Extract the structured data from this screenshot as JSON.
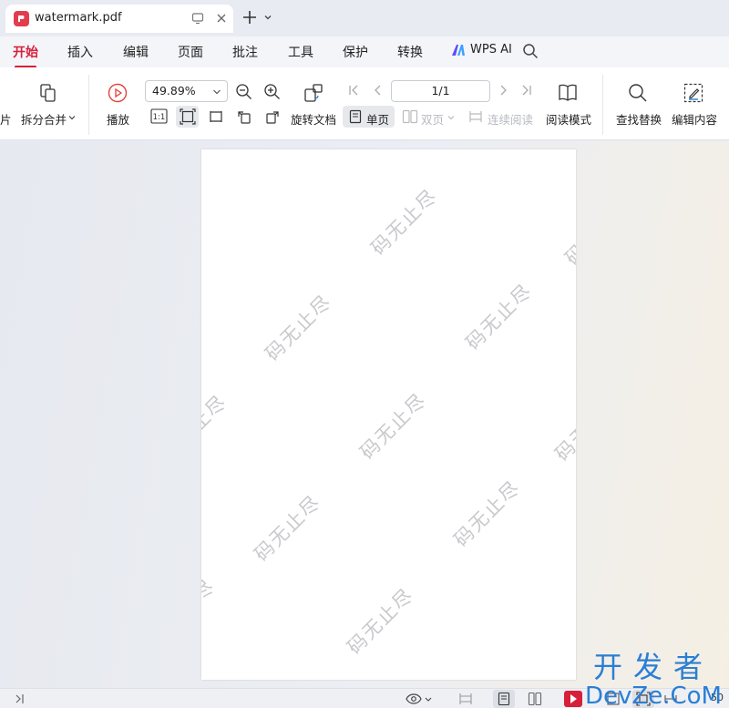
{
  "tab": {
    "title": "watermark.pdf",
    "icon": "pdf-icon"
  },
  "menu": {
    "items": [
      "开始",
      "插入",
      "编辑",
      "页面",
      "批注",
      "工具",
      "保护",
      "转换"
    ],
    "ai_label": "WPS AI"
  },
  "toolbar": {
    "partial_left": "片",
    "split_merge": "拆分合并",
    "play": "播放",
    "zoom": "49.89%",
    "actual_size": "1:1",
    "rotate_doc": "旋转文档",
    "single_page": "单页",
    "double_page": "双页",
    "continuous": "连续阅读",
    "page_indicator": "1/1",
    "read_mode": "阅读模式",
    "find_replace": "查找替换",
    "edit_content": "编辑内容"
  },
  "watermark": {
    "text": "码无止尽"
  },
  "statusbar": {
    "zoom_partial": "50"
  },
  "brand": {
    "top": "开发者",
    "bottom": "DevZe.CoM",
    "color": "#2a7fd4"
  },
  "colors": {
    "accent": "#d6203a",
    "pdf_icon": "#e23d4d"
  }
}
